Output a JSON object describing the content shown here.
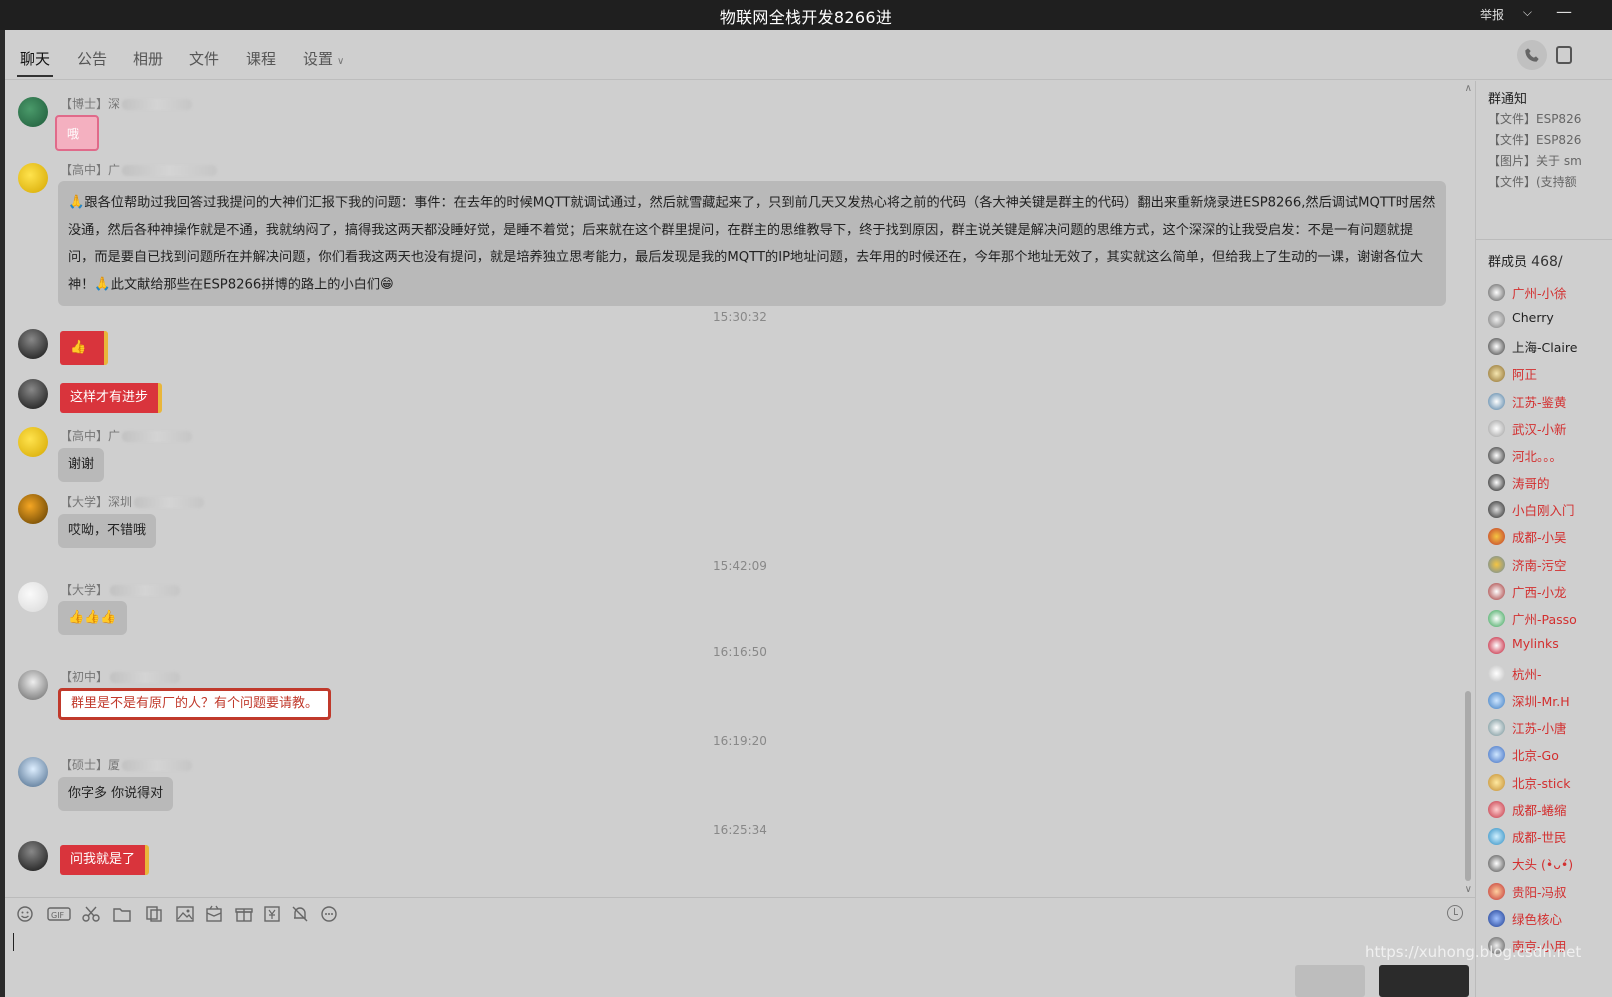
{
  "window": {
    "title": "物联网全栈开发8266进",
    "report_label": "举报",
    "minimize_label": "—"
  },
  "tabs": [
    {
      "label": "聊天",
      "active": true
    },
    {
      "label": "公告"
    },
    {
      "label": "相册"
    },
    {
      "label": "文件"
    },
    {
      "label": "课程"
    },
    {
      "label": "设置"
    }
  ],
  "messages": [
    {
      "sender_level": "【博士】深",
      "type": "sticker",
      "sticker_text": "哦"
    },
    {
      "sender_level": "【高中】广",
      "type": "text_long",
      "text_1": "跟各位帮助过我回答过我提问的大神们汇报下我的问题：事件：在去年的时候MQTT就调试通过，然后就雪藏起来了，只到前几天又发热心将之前的代码（各大神关键是群主的代码）翻出来重新烧录进ESP8266,然后调试MQTT时居然没通，然后各种神操作就是不通，我就纳闷了，搞得我这两天都没睡好觉，是睡不着觉；后来就在这个群里提问，在群主的思维教导下，终于找到原因，群主说关键是解决问题的思维方式，这个深深的让我受启发：不是一有问题就提问，而是要自已找到问题所在并解决问题，你们看我这两天也没有提问，就是培养独立思考能力，最后发现是我的MQTT的IP地址问题，去年用的时候还在，今年那个地址无效了，其实就这么简单，但给我上了生动的一课，谢谢各位大神！",
      "text_2": "此文献给那些在ESP8266拼博的路上的小白们"
    },
    {
      "time": "15:30:32"
    },
    {
      "type": "red_emoji",
      "emoji": "👍"
    },
    {
      "type": "red_text",
      "text": "这样才有进步"
    },
    {
      "sender_level": "【高中】广",
      "type": "text",
      "text": "谢谢"
    },
    {
      "sender_level": "【大学】深圳",
      "type": "text",
      "text": "哎呦，不错哦"
    },
    {
      "time": "15:42:09"
    },
    {
      "sender_level": "【大学】",
      "type": "emoji_row",
      "text": "👍👍👍"
    },
    {
      "time": "16:16:50"
    },
    {
      "sender_level": "【初中】",
      "type": "red_frame",
      "text": "群里是不是有原厂的人？有个问题要请教。"
    },
    {
      "time": "16:19:20"
    },
    {
      "sender_level": "【硕士】厦",
      "type": "text",
      "text": "你字多 你说得对"
    },
    {
      "time": "16:25:34"
    },
    {
      "type": "red_text",
      "text": "问我就是了"
    }
  ],
  "right_panel": {
    "notice_title": "群通知",
    "notices": [
      "【文件】ESP826",
      "【文件】ESP826",
      "【图片】关于 sm",
      "【文件】(支持额"
    ],
    "members_title": "群成员",
    "members_count": "468/",
    "members": [
      {
        "name": "广州-小徐",
        "highlight": true
      },
      {
        "name": "Cherry",
        "highlight": false
      },
      {
        "name": "上海-Claire",
        "highlight": false
      },
      {
        "name": "阿正",
        "highlight": true
      },
      {
        "name": "江苏-鉴黄",
        "highlight": true
      },
      {
        "name": "武汉-小新",
        "highlight": true
      },
      {
        "name": "河北。。。",
        "highlight": true
      },
      {
        "name": "涛哥的",
        "highlight": true
      },
      {
        "name": "小白刚入门",
        "highlight": true
      },
      {
        "name": "成都-小吴",
        "highlight": true
      },
      {
        "name": "济南-污空",
        "highlight": true
      },
      {
        "name": "广西-小龙",
        "highlight": true
      },
      {
        "name": "广州-Passo",
        "highlight": true
      },
      {
        "name": "Mylinks",
        "highlight": true
      },
      {
        "name": "杭州-",
        "highlight": true
      },
      {
        "name": "深圳-Mr.H",
        "highlight": true
      },
      {
        "name": "江苏-小唐",
        "highlight": true
      },
      {
        "name": "北京-Go",
        "highlight": true
      },
      {
        "name": "北京-stick",
        "highlight": true
      },
      {
        "name": "成都-蜷缩",
        "highlight": true
      },
      {
        "name": "成都-世民",
        "highlight": true
      },
      {
        "name": "大头 (•̀ᴗ•́)",
        "highlight": true
      },
      {
        "name": "贵阳-冯叔",
        "highlight": true
      },
      {
        "name": "绿色核心",
        "highlight": true
      },
      {
        "name": "南京-小用",
        "highlight": true
      }
    ]
  },
  "watermark": "https://xuhong.blog.csdn.net",
  "colors": {
    "red_bubble": "#d9343c",
    "member_highlight": "#d32f2f",
    "titlebar": "#1f1f1f"
  }
}
